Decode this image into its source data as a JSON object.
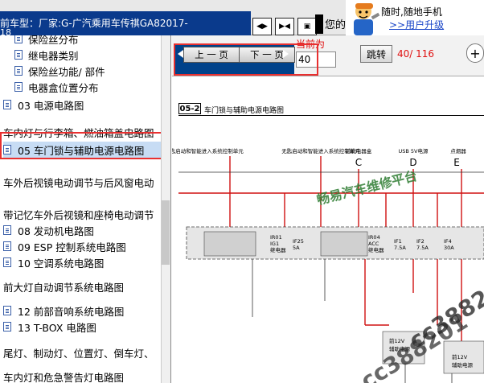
{
  "header": {
    "model_label": "前车型：",
    "model_value": "厂家:G-广汽乘用车传祺GA82017-",
    "model_suffix": "18",
    "greeting": "您的",
    "promo_line": "随时,随地手机",
    "promo_link": ">>用户升级"
  },
  "sidebar": {
    "items": [
      {
        "label": "保险丝分布",
        "level": "sub",
        "icon": "doc-icon"
      },
      {
        "label": "继电器类别",
        "level": "sub",
        "icon": "doc-icon"
      },
      {
        "label": "保险丝功能/ 部件",
        "level": "sub",
        "icon": "doc-icon"
      },
      {
        "label": "电器盒位置分布",
        "level": "sub",
        "icon": "doc-icon"
      },
      {
        "label": "03 电源电路图",
        "level": "top",
        "icon": "doc-icon"
      },
      {
        "label": "车内灯与行李箱、燃油箱盖电路图",
        "level": "text",
        "icon": ""
      },
      {
        "label": "05 车门锁与辅助电源电路图",
        "level": "top",
        "icon": "doc-icon",
        "selected": true
      },
      {
        "label": "车外后视镜电动调节与后风窗电动",
        "level": "text",
        "icon": ""
      },
      {
        "label": "带记忆车外后视镜和座椅电动调节",
        "level": "text",
        "icon": ""
      },
      {
        "label": "08 发动机电路图",
        "level": "top",
        "icon": "doc-icon"
      },
      {
        "label": "09 ESP 控制系统电路图",
        "level": "top",
        "icon": "doc-icon"
      },
      {
        "label": "10 空调系统电路图",
        "level": "top",
        "icon": "doc-icon"
      },
      {
        "label": "前大灯自动调节系统电路图",
        "level": "text",
        "icon": ""
      },
      {
        "label": "12 前部音响系统电路图",
        "level": "top",
        "icon": "doc-icon"
      },
      {
        "label": "13 T-BOX 电路图",
        "level": "top",
        "icon": "doc-icon"
      },
      {
        "label": "尾灯、制动灯、位置灯、倒车灯、",
        "level": "text",
        "icon": ""
      },
      {
        "label": "车内灯和危急警告灯电路图",
        "level": "text",
        "icon": ""
      }
    ]
  },
  "toolbar": {
    "prev_label": "上 一 页",
    "next_label": "下 一 页",
    "current_label": "当前为",
    "page_value": "40",
    "jump_label": "跳转",
    "page_count": "40/ 116",
    "zoom_symbol": "+"
  },
  "diagram": {
    "id": "05-2",
    "title": "车门锁与辅助电源电路图",
    "column_labels": [
      "无匙启动和智能进入系统控制单元",
      "无匙启动和智能进入系统控制单元",
      "前舱电器盒",
      "USB 5V电源",
      "点烟器"
    ],
    "letters": [
      "C",
      "D",
      "E"
    ],
    "relay_1": [
      "IR01",
      "IG1",
      "继电器"
    ],
    "fuse_1": [
      "IF25",
      "5A"
    ],
    "relay_2": [
      "IR04",
      "ACC",
      "继电器"
    ],
    "fuse_2": [
      "IF1",
      "7.5A"
    ],
    "fuse_3": [
      "IF2",
      "7.5A"
    ],
    "fuse_4": [
      "IF4",
      "30A"
    ],
    "device_1": [
      "前12V",
      "辅助电源"
    ],
    "device_2": [
      "前12V",
      "辅助电源"
    ]
  },
  "watermarks": {
    "platform": "畅易汽车维修平台",
    "site_1": "cc388201",
    "site_2": "cc388201"
  },
  "colors": {
    "header_bar": "#0a3a8c",
    "page_controls": "#00428a",
    "highlight": "#e83030",
    "wire_red": "#d01010",
    "watermark_green": "#2f7d32"
  }
}
